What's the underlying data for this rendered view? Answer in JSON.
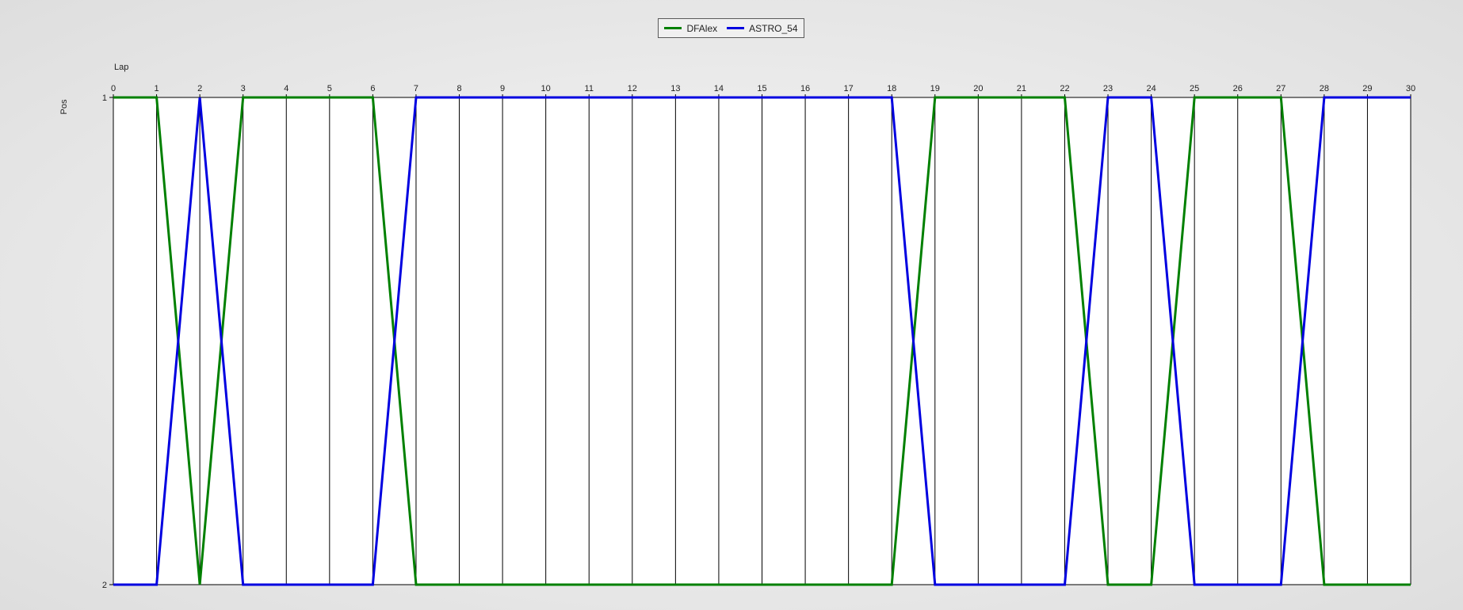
{
  "chart_data": {
    "type": "line",
    "xlabel": "Lap",
    "ylabel": "Pos",
    "xlim": [
      0,
      30
    ],
    "ylim": [
      1,
      2
    ],
    "x": [
      0,
      1,
      2,
      3,
      4,
      5,
      6,
      7,
      8,
      9,
      10,
      11,
      12,
      13,
      14,
      15,
      16,
      17,
      18,
      19,
      20,
      21,
      22,
      23,
      24,
      25,
      26,
      27,
      28,
      29,
      30
    ],
    "x_ticks": [
      "0",
      "1",
      "2",
      "3",
      "4",
      "5",
      "6",
      "7",
      "8",
      "9",
      "10",
      "11",
      "12",
      "13",
      "14",
      "15",
      "16",
      "17",
      "18",
      "19",
      "20",
      "21",
      "22",
      "23",
      "24",
      "25",
      "26",
      "27",
      "28",
      "29",
      "30"
    ],
    "y_ticks": [
      "1",
      "2"
    ],
    "grid": "vertical",
    "legend_placement": "top-center",
    "series": [
      {
        "name": "DFAlex",
        "color": "#008000",
        "values": [
          1,
          1,
          2,
          1,
          1,
          1,
          1,
          2,
          2,
          2,
          2,
          2,
          2,
          2,
          2,
          2,
          2,
          2,
          2,
          1,
          1,
          1,
          1,
          2,
          2,
          1,
          1,
          1,
          2,
          2,
          2
        ]
      },
      {
        "name": "ASTRO_54",
        "color": "#0000e0",
        "values": [
          2,
          2,
          1,
          2,
          2,
          2,
          2,
          1,
          1,
          1,
          1,
          1,
          1,
          1,
          1,
          1,
          1,
          1,
          1,
          2,
          2,
          2,
          2,
          1,
          1,
          2,
          2,
          2,
          1,
          1,
          1
        ]
      }
    ]
  }
}
